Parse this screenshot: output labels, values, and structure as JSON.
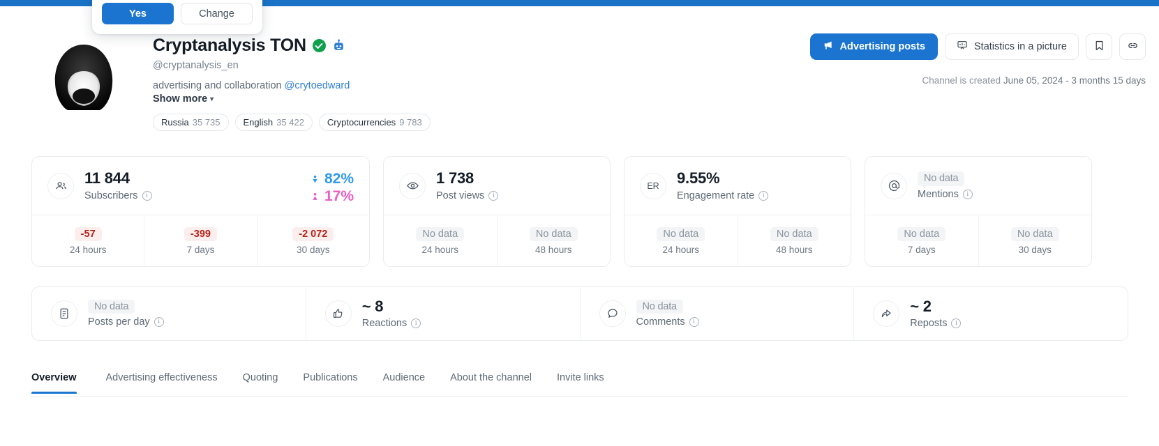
{
  "topbar": {
    "color": "#1a73c7"
  },
  "confirm_popup": {
    "yes_label": "Yes",
    "change_label": "Change"
  },
  "channel": {
    "title": "Cryptanalysis TON",
    "handle": "@cryptanalysis_en",
    "description_text": "advertising and collaboration",
    "description_mention": "@crytoedward",
    "show_more_label": "Show more",
    "verified": true,
    "tags": [
      {
        "name": "Russia",
        "value": "35 735"
      },
      {
        "name": "English",
        "value": "35 422"
      },
      {
        "name": "Cryptocurrencies",
        "value": "9 783"
      }
    ]
  },
  "header_actions": {
    "advertising_posts": "Advertising posts",
    "statistics_in_a_picture": "Statistics in a picture",
    "bookmark_icon": "bookmark-icon",
    "link_icon": "link-icon"
  },
  "created_note": {
    "prefix": "Channel is created",
    "date": "June 05, 2024",
    "age": "- 3 months 15 days"
  },
  "cards": {
    "subscribers": {
      "icon": "people-icon",
      "value": "11 844",
      "label": "Subscribers",
      "male_pct": "82%",
      "female_pct": "17%",
      "cells": [
        {
          "value": "-57",
          "label": "24 hours",
          "state": "neg"
        },
        {
          "value": "-399",
          "label": "7 days",
          "state": "neg"
        },
        {
          "value": "-2 072",
          "label": "30 days",
          "state": "neg"
        }
      ]
    },
    "post_views": {
      "icon": "eye-icon",
      "value": "1 738",
      "label": "Post views",
      "cells": [
        {
          "value": "No data",
          "label": "24 hours",
          "state": "none"
        },
        {
          "value": "No data",
          "label": "48 hours",
          "state": "none"
        }
      ]
    },
    "engagement_rate": {
      "icon": "ER",
      "value": "9.55%",
      "label": "Engagement rate",
      "cells": [
        {
          "value": "No data",
          "label": "24 hours",
          "state": "none"
        },
        {
          "value": "No data",
          "label": "48 hours",
          "state": "none"
        }
      ]
    },
    "mentions": {
      "icon": "at-icon",
      "value": "No data",
      "label": "Mentions",
      "cells": [
        {
          "value": "No data",
          "label": "7 days",
          "state": "none"
        },
        {
          "value": "No data",
          "label": "30 days",
          "state": "none"
        }
      ]
    }
  },
  "engagement_strip": [
    {
      "icon": "document-icon",
      "value": "No data",
      "label": "Posts per day",
      "state": "none"
    },
    {
      "icon": "thumbs-up-icon",
      "value": "~ 8",
      "label": "Reactions",
      "state": "value"
    },
    {
      "icon": "comment-icon",
      "value": "No data",
      "label": "Comments",
      "state": "none"
    },
    {
      "icon": "repost-icon",
      "value": "~ 2",
      "label": "Reposts",
      "state": "value"
    }
  ],
  "tabs": [
    {
      "label": "Overview",
      "active": true
    },
    {
      "label": "Advertising effectiveness",
      "active": false
    },
    {
      "label": "Quoting",
      "active": false
    },
    {
      "label": "Publications",
      "active": false
    },
    {
      "label": "Audience",
      "active": false
    },
    {
      "label": "About the channel",
      "active": false
    },
    {
      "label": "Invite links",
      "active": false
    }
  ],
  "colors": {
    "accent": "#1b75d0",
    "verified_green": "#0fa04c",
    "male_blue": "#2f9ae8",
    "female_pink": "#e85fc4",
    "negative_red": "#b42318"
  }
}
